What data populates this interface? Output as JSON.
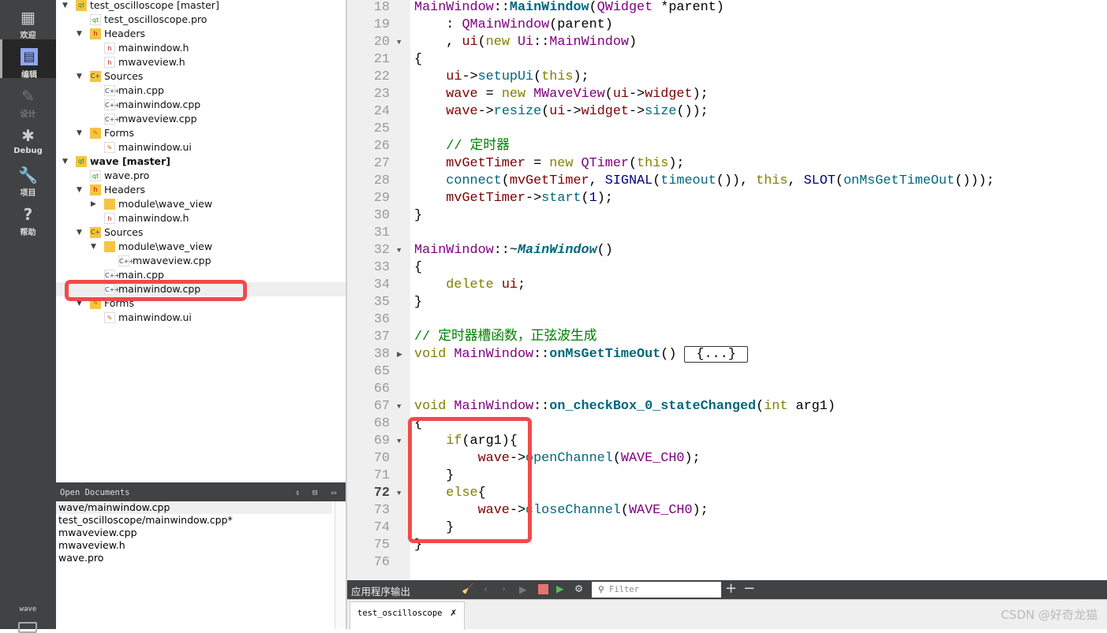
{
  "sidebar": {
    "modes": [
      {
        "label": "欢迎",
        "icon": "grid-icon",
        "glyph": "▦"
      },
      {
        "label": "编辑",
        "icon": "document-icon",
        "glyph": "▤",
        "selected": true
      },
      {
        "label": "设计",
        "icon": "pencil-icon",
        "glyph": "✎",
        "disabled": true
      },
      {
        "label": "Debug",
        "icon": "bug-icon",
        "glyph": "✱"
      },
      {
        "label": "项目",
        "icon": "wrench-icon",
        "glyph": "🔧"
      },
      {
        "label": "帮助",
        "icon": "help-icon",
        "glyph": "?"
      }
    ],
    "project_label": "wave"
  },
  "tree": [
    {
      "label": "test_oscilloscope [master]",
      "level": 0,
      "arrow": "down",
      "icon": "qt-folder"
    },
    {
      "label": "test_oscilloscope.pro",
      "level": 1,
      "icon": "pro"
    },
    {
      "label": "Headers",
      "level": 1,
      "arrow": "down",
      "icon": "h-folder"
    },
    {
      "label": "mainwindow.h",
      "level": 2,
      "icon": "h"
    },
    {
      "label": "mwaveview.h",
      "level": 2,
      "icon": "h"
    },
    {
      "label": "Sources",
      "level": 1,
      "arrow": "down",
      "icon": "cpp-folder"
    },
    {
      "label": "main.cpp",
      "level": 2,
      "icon": "cpp"
    },
    {
      "label": "mainwindow.cpp",
      "level": 2,
      "icon": "cpp"
    },
    {
      "label": "mwaveview.cpp",
      "level": 2,
      "icon": "cpp"
    },
    {
      "label": "Forms",
      "level": 1,
      "arrow": "down",
      "icon": "form-folder"
    },
    {
      "label": "mainwindow.ui",
      "level": 2,
      "icon": "ui"
    },
    {
      "label": "wave [master]",
      "level": 0,
      "arrow": "down",
      "icon": "qt-folder",
      "bold": true
    },
    {
      "label": "wave.pro",
      "level": 1,
      "icon": "pro"
    },
    {
      "label": "Headers",
      "level": 1,
      "arrow": "down",
      "icon": "h-folder"
    },
    {
      "label": "module\\wave_view",
      "level": 2,
      "arrow": "right",
      "icon": "folder"
    },
    {
      "label": "mainwindow.h",
      "level": 2,
      "icon": "h"
    },
    {
      "label": "Sources",
      "level": 1,
      "arrow": "down",
      "icon": "cpp-folder"
    },
    {
      "label": "module\\wave_view",
      "level": 2,
      "arrow": "down",
      "icon": "folder"
    },
    {
      "label": "mwaveview.cpp",
      "level": 3,
      "icon": "cpp"
    },
    {
      "label": "main.cpp",
      "level": 2,
      "icon": "cpp"
    },
    {
      "label": "mainwindow.cpp",
      "level": 2,
      "icon": "cpp",
      "selected": true
    },
    {
      "label": "Forms",
      "level": 1,
      "arrow": "down",
      "icon": "form-folder"
    },
    {
      "label": "mainwindow.ui",
      "level": 2,
      "icon": "ui"
    }
  ],
  "open_documents": {
    "title": "Open Documents",
    "items": [
      "wave/mainwindow.cpp",
      "test_oscilloscope/mainwindow.cpp*",
      "mwaveview.cpp",
      "mwaveview.h",
      "wave.pro"
    ]
  },
  "editor": {
    "current_line": 72,
    "lines": [
      {
        "n": 18,
        "t": [
          [
            "MainWindow",
            "cls"
          ],
          [
            "::",
            ""
          ],
          [
            "MainWindow",
            "fnb"
          ],
          [
            "(",
            ""
          ],
          [
            "QWidget",
            "cls"
          ],
          [
            " *parent)",
            ""
          ]
        ]
      },
      {
        "n": 19,
        "t": [
          [
            "    : ",
            ""
          ],
          [
            "QMainWindow",
            "cls"
          ],
          [
            "(parent)",
            ""
          ]
        ]
      },
      {
        "n": 20,
        "fold": "down",
        "t": [
          [
            "    , ",
            ""
          ],
          [
            "ui",
            "mem"
          ],
          [
            "(",
            ""
          ],
          [
            "new",
            "kw"
          ],
          [
            " ",
            ""
          ],
          [
            "Ui",
            "cls"
          ],
          [
            "::",
            ""
          ],
          [
            "MainWindow",
            "cls"
          ],
          [
            ")",
            ""
          ]
        ]
      },
      {
        "n": 21,
        "t": [
          [
            "{",
            ""
          ]
        ]
      },
      {
        "n": 22,
        "t": [
          [
            "    ",
            ""
          ],
          [
            "ui",
            "mem"
          ],
          [
            "->",
            ""
          ],
          [
            "setupUi",
            "fn"
          ],
          [
            "(",
            ""
          ],
          [
            "this",
            "kw"
          ],
          [
            ");",
            ""
          ]
        ]
      },
      {
        "n": 23,
        "t": [
          [
            "    ",
            ""
          ],
          [
            "wave",
            "mem"
          ],
          [
            " = ",
            ""
          ],
          [
            "new",
            "kw"
          ],
          [
            " ",
            ""
          ],
          [
            "MWaveView",
            "cls"
          ],
          [
            "(",
            ""
          ],
          [
            "ui",
            "mem"
          ],
          [
            "->",
            ""
          ],
          [
            "widget",
            "mem"
          ],
          [
            ");",
            ""
          ]
        ]
      },
      {
        "n": 24,
        "t": [
          [
            "    ",
            ""
          ],
          [
            "wave",
            "mem"
          ],
          [
            "->",
            ""
          ],
          [
            "resize",
            "fn"
          ],
          [
            "(",
            ""
          ],
          [
            "ui",
            "mem"
          ],
          [
            "->",
            ""
          ],
          [
            "widget",
            "mem"
          ],
          [
            "->",
            ""
          ],
          [
            "size",
            "fn"
          ],
          [
            "());",
            ""
          ]
        ]
      },
      {
        "n": 25,
        "t": []
      },
      {
        "n": 26,
        "t": [
          [
            "    ",
            ""
          ],
          [
            "// 定时器",
            "cm"
          ]
        ]
      },
      {
        "n": 27,
        "t": [
          [
            "    ",
            ""
          ],
          [
            "mvGetTimer",
            "mem"
          ],
          [
            " = ",
            ""
          ],
          [
            "new",
            "kw"
          ],
          [
            " ",
            ""
          ],
          [
            "QTimer",
            "cls"
          ],
          [
            "(",
            ""
          ],
          [
            "this",
            "kw"
          ],
          [
            ");",
            ""
          ]
        ]
      },
      {
        "n": 28,
        "t": [
          [
            "    ",
            ""
          ],
          [
            "connect",
            "fn"
          ],
          [
            "(",
            ""
          ],
          [
            "mvGetTimer",
            "mem"
          ],
          [
            ", ",
            ""
          ],
          [
            "SIGNAL",
            "mac"
          ],
          [
            "(",
            ""
          ],
          [
            "timeout",
            "fn"
          ],
          [
            "()), ",
            ""
          ],
          [
            "this",
            "kw"
          ],
          [
            ", ",
            ""
          ],
          [
            "SLOT",
            "mac"
          ],
          [
            "(",
            ""
          ],
          [
            "onMsGetTimeOut",
            "fn"
          ],
          [
            "()));",
            ""
          ]
        ]
      },
      {
        "n": 29,
        "t": [
          [
            "    ",
            ""
          ],
          [
            "mvGetTimer",
            "mem"
          ],
          [
            "->",
            ""
          ],
          [
            "start",
            "fn"
          ],
          [
            "(",
            ""
          ],
          [
            "1",
            "num"
          ],
          [
            ");",
            ""
          ]
        ]
      },
      {
        "n": 30,
        "t": [
          [
            "}",
            ""
          ]
        ]
      },
      {
        "n": 31,
        "t": []
      },
      {
        "n": 32,
        "fold": "down",
        "t": [
          [
            "MainWindow",
            "cls"
          ],
          [
            "::~",
            ""
          ],
          [
            "MainWindow",
            "fni"
          ],
          [
            "()",
            ""
          ]
        ]
      },
      {
        "n": 33,
        "t": [
          [
            "{",
            ""
          ]
        ]
      },
      {
        "n": 34,
        "t": [
          [
            "    ",
            ""
          ],
          [
            "delete",
            "kw"
          ],
          [
            " ",
            ""
          ],
          [
            "ui",
            "mem"
          ],
          [
            ";",
            ""
          ]
        ]
      },
      {
        "n": 35,
        "t": [
          [
            "}",
            ""
          ]
        ]
      },
      {
        "n": 36,
        "t": []
      },
      {
        "n": 37,
        "t": [
          [
            "// 定时器槽函数，正弦波生成",
            "cm"
          ]
        ]
      },
      {
        "n": 38,
        "fold": "right",
        "t": [
          [
            "void",
            "kw"
          ],
          [
            " ",
            ""
          ],
          [
            "MainWindow",
            "cls"
          ],
          [
            "::",
            ""
          ],
          [
            "onMsGetTimeOut",
            "fnb"
          ],
          [
            "()",
            ""
          ]
        ],
        "collapsed": "{...}"
      },
      {
        "n": 65,
        "t": []
      },
      {
        "n": 66,
        "t": []
      },
      {
        "n": 67,
        "fold": "down",
        "t": [
          [
            "void",
            "kw"
          ],
          [
            " ",
            ""
          ],
          [
            "MainWindow",
            "cls"
          ],
          [
            "::",
            ""
          ],
          [
            "on_checkBox_0_stateChanged",
            "fnb"
          ],
          [
            "(",
            ""
          ],
          [
            "int",
            "kw"
          ],
          [
            " arg1)",
            ""
          ]
        ]
      },
      {
        "n": 68,
        "t": [
          [
            "{",
            ""
          ]
        ]
      },
      {
        "n": 69,
        "fold": "down",
        "t": [
          [
            "    ",
            ""
          ],
          [
            "if",
            "kw"
          ],
          [
            "(arg1){",
            ""
          ]
        ]
      },
      {
        "n": 70,
        "t": [
          [
            "        ",
            ""
          ],
          [
            "wave",
            "mem"
          ],
          [
            "->",
            ""
          ],
          [
            "openChannel",
            "fn"
          ],
          [
            "(",
            ""
          ],
          [
            "WAVE_CH0",
            "cls"
          ],
          [
            ");",
            ""
          ]
        ]
      },
      {
        "n": 71,
        "t": [
          [
            "    }",
            ""
          ]
        ]
      },
      {
        "n": 72,
        "fold": "down",
        "t": [
          [
            "    ",
            ""
          ],
          [
            "else",
            "kw"
          ],
          [
            "{",
            ""
          ]
        ]
      },
      {
        "n": 73,
        "t": [
          [
            "        ",
            ""
          ],
          [
            "wave",
            "mem"
          ],
          [
            "->",
            ""
          ],
          [
            "closeChannel",
            "fn"
          ],
          [
            "(",
            ""
          ],
          [
            "WAVE_CH0",
            "cls"
          ],
          [
            ");",
            ""
          ]
        ]
      },
      {
        "n": 74,
        "t": [
          [
            "    }",
            ""
          ]
        ]
      },
      {
        "n": 75,
        "t": [
          [
            "}",
            ""
          ]
        ]
      },
      {
        "n": 76,
        "t": []
      }
    ]
  },
  "output": {
    "title": "应用程序输出",
    "filter_placeholder": "Filter",
    "tab": "test_oscilloscope",
    "colors": {
      "stop": "#e57373",
      "run": "#5cb85c"
    }
  },
  "annotations": {
    "color": "#f24a4a"
  },
  "watermark": "CSDN @好奇龙猫"
}
